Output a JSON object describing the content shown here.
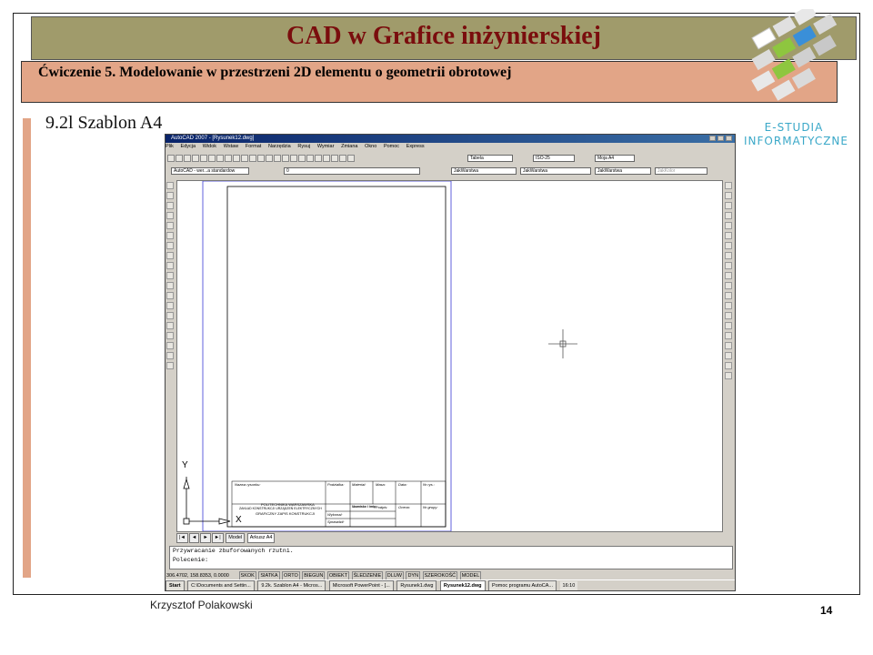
{
  "slide": {
    "title": "CAD w Grafice inżynierskiej",
    "subtitle": "Ćwiczenie 5. Modelowanie w przestrzeni 2D elementu o geometrii obrotowej",
    "section": "9.2l Szablon A4",
    "author": "Krzysztof Polakowski",
    "page_number": "14",
    "brand_line1": "E-STUDIA",
    "brand_line2": "INFORMATYCZNE"
  },
  "autocad": {
    "window_title": "AutoCAD 2007 - [Rysunek12.dwg]",
    "menu": [
      "Plik",
      "Edycja",
      "Widok",
      "Wstaw",
      "Format",
      "Narzędzia",
      "Rysuj",
      "Wymiar",
      "Zmiana",
      "Okno",
      "Pomoc",
      "Express"
    ],
    "text_style": "Tabela",
    "dim_style": "ISO-25",
    "table_style": "Moja A4",
    "workspace": "AutoCAD - wer...a standardow",
    "layer": "0",
    "color": "JakWarstwa",
    "linetype": "JakWarstwa",
    "lineweight": "JakWarstwa",
    "plotstyle": "JakKolor",
    "tabs": [
      "Model",
      "Arkusz A4"
    ],
    "command_lines": [
      "Przywracanie zbuforowanych rzutni.",
      "Polecenie:"
    ],
    "coordinates": "306.4702, 158.8353, 0.0000",
    "status_buttons": [
      "SKOK",
      "SIATKA",
      "ORTO",
      "BIEGUN",
      "OBIEKT",
      "ŚLEDZENIE",
      "DLUW",
      "DYN",
      "SZEROKOŚĆ",
      "MODEL"
    ],
    "taskbar": {
      "start": "Start",
      "items": [
        "C:\\Documents and Settin...",
        "9.2k. Szablon A4 - Micros...",
        "Microsoft PowerPoint - [...",
        "Rysunek1.dwg",
        "Rysunek12.dwg",
        "Pomoc programu AutoCA..."
      ],
      "clock": "16:10"
    },
    "ucs_y": "Y",
    "ucs_x": "X",
    "title_block": {
      "nazwa": "Nazwa rysunku:",
      "podzialka": "Podziałka:",
      "material": "Materiał:",
      "masa": "Masa:",
      "data": "Data:",
      "nr_rys": "Nr rys.:",
      "uczelnia_1": "POLITECHNIKA WARSZAWSKA",
      "uczelnia_2": "ZAKŁAD KONSTRUKCJI URZĄDZEŃ ELEKTRYCZNYCH",
      "uczelnia_3": "GRAFICZNY ZAPIS KONSTRUKCJI",
      "nazwisko": "Nazwisko i imię:",
      "podpis": "Podpis:",
      "ocena": "Ocena:",
      "nr_grupy": "Nr grupy:",
      "wykonal": "Wykonał:",
      "sprawdzil": "Sprawdził:"
    }
  }
}
